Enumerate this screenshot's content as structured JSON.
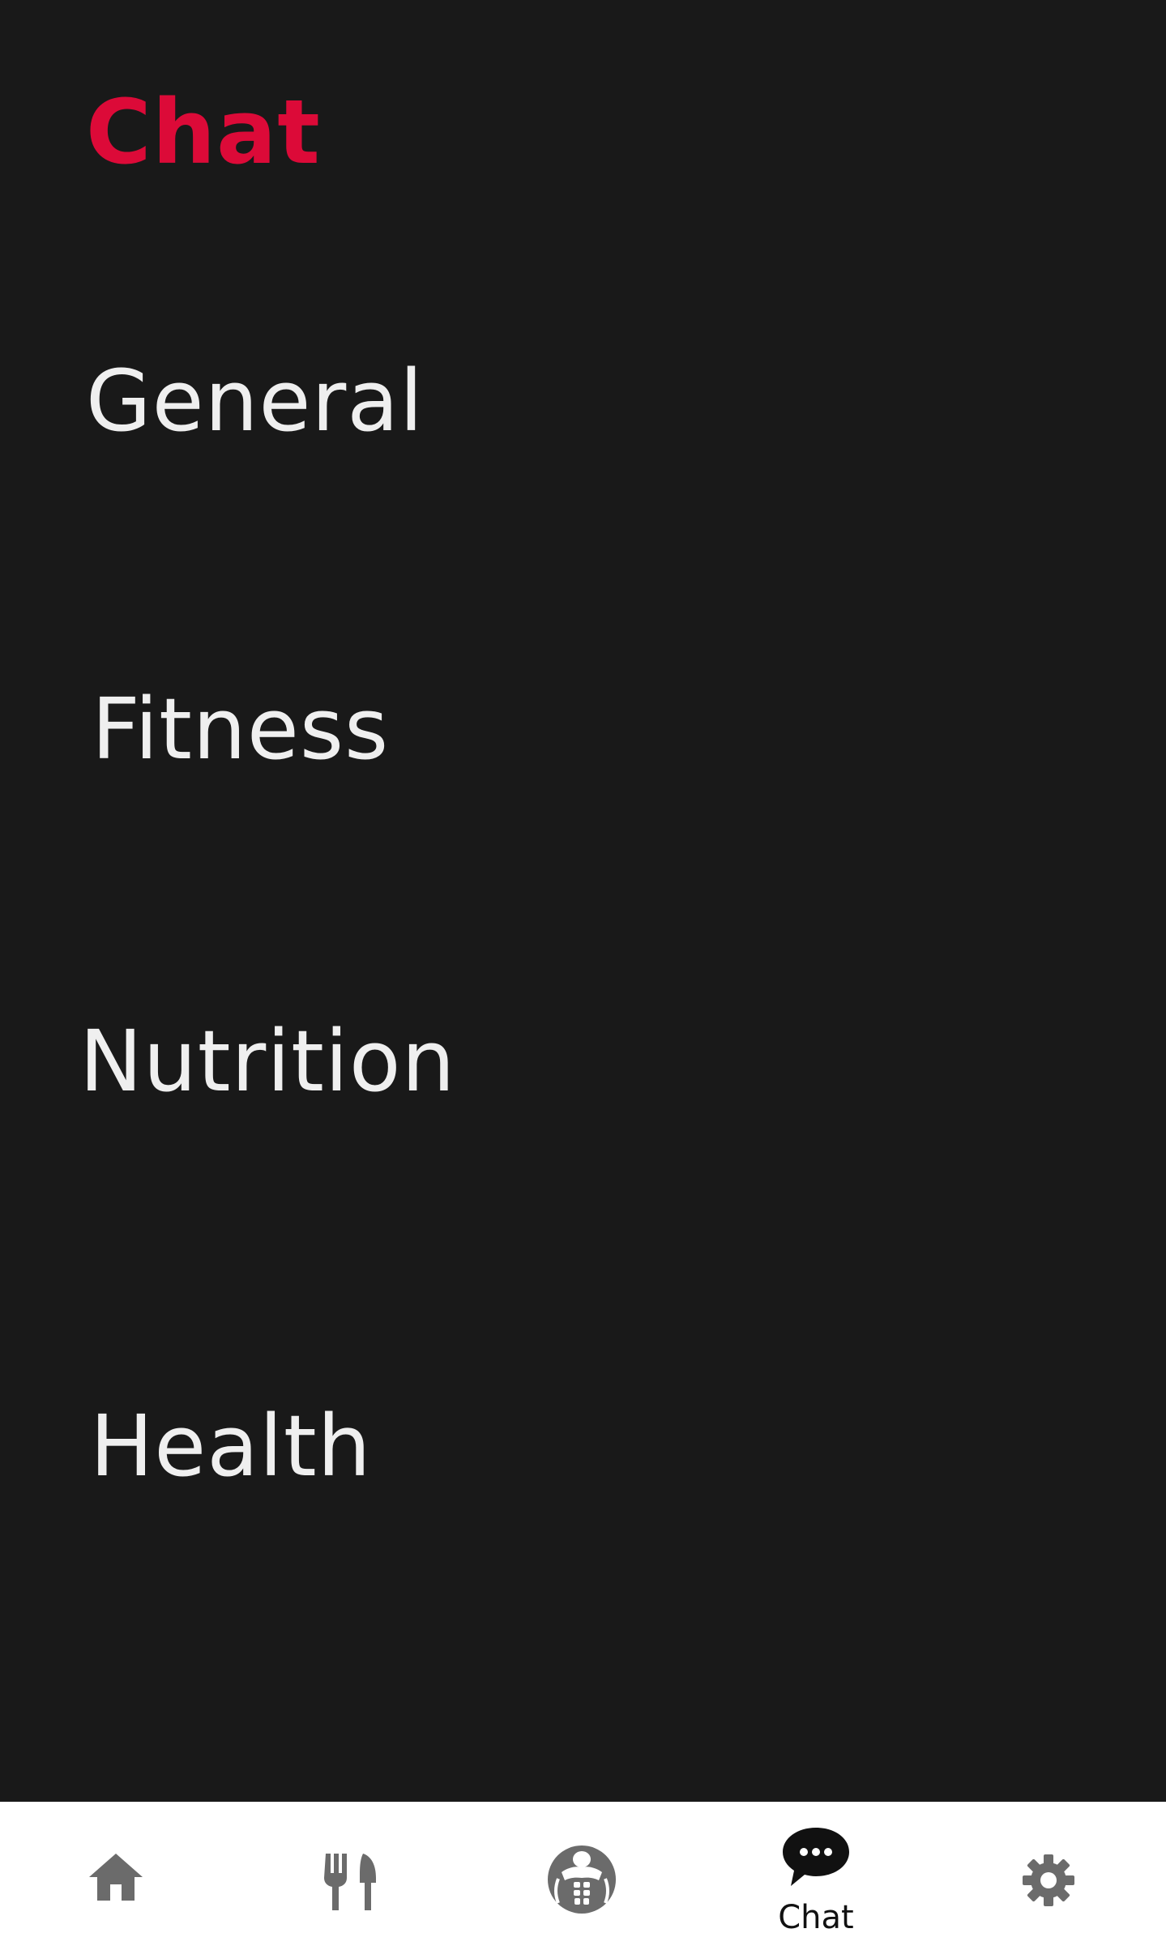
{
  "header": {
    "title": "Chat"
  },
  "categories": [
    {
      "label": "General"
    },
    {
      "label": "Fitness"
    },
    {
      "label": "Nutrition"
    },
    {
      "label": "Health"
    }
  ],
  "bottom_nav": {
    "items": [
      {
        "icon": "home-icon",
        "label": ""
      },
      {
        "icon": "fork-knife-icon",
        "label": ""
      },
      {
        "icon": "muscle-body-icon",
        "label": ""
      },
      {
        "icon": "chat-bubble-icon",
        "label": "Chat",
        "active": true
      },
      {
        "icon": "gear-icon",
        "label": ""
      }
    ]
  },
  "colors": {
    "background": "#191919",
    "accent": "#dc0a38",
    "text": "#efefef",
    "nav_background": "#ffffff",
    "nav_icon_inactive": "#6b6b6b",
    "nav_icon_active": "#111111"
  }
}
